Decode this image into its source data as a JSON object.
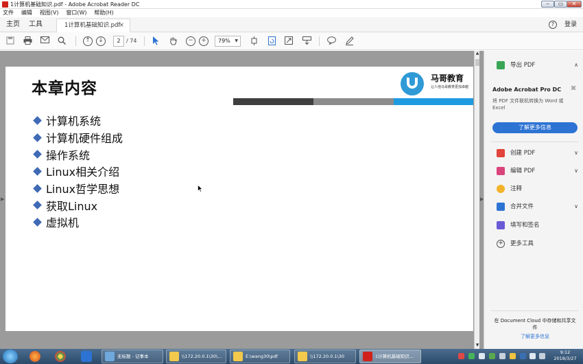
{
  "window": {
    "title": "1计算机基础知识.pdf - Adobe Acrobat Reader DC",
    "minimize": "‒",
    "maximize": "▭",
    "close": "✕"
  },
  "menu": [
    "文件",
    "编辑",
    "视图(V)",
    "窗口(W)",
    "帮助(H)"
  ],
  "nav": {
    "home": "主页",
    "tools": "工具",
    "doc_tab": "1计算机基础知识.pdf",
    "doc_tab_close": "×",
    "help": "?",
    "login": "登录"
  },
  "toolbar": {
    "page_current": "2",
    "page_total": "/ 74",
    "zoom": "79%",
    "icons": [
      "save-icon",
      "print-icon",
      "email-icon",
      "search-icon",
      "page-up-icon",
      "page-down-icon",
      "select-icon",
      "hand-icon",
      "zoom-out-icon",
      "zoom-in-icon",
      "fit-page-icon",
      "rotate-icon",
      "fullscreen-icon",
      "annotate-icon",
      "comment-icon",
      "sign-icon"
    ]
  },
  "document": {
    "heading": "本章内容",
    "logo_brand": "马哥教育",
    "logo_tagline": "让人他马哥教育更加卓越",
    "bullets": [
      "计算机系统",
      "计算机硬件组成",
      "操作系统",
      "Linux相关介绍",
      "Linux哲学思想",
      "获取Linux",
      "虚拟机"
    ],
    "colors": {
      "bar_dark": "#3f3f3f",
      "bar_mid": "#8c8c8c",
      "bar_accent": "#1e9be0",
      "bullet": "#3f6ab5"
    }
  },
  "right_panel": {
    "export_pdf": "导出 PDF",
    "promo_title": "Adobe Acrobat Pro DC",
    "promo_sub": "将 PDF 文件联机转换为 Word 或 Excel",
    "promo_button": "了解更多信息",
    "tools": [
      {
        "label": "创建 PDF",
        "icon": "create-pdf-icon",
        "color": "#e0443a",
        "has_caret": true
      },
      {
        "label": "编辑 PDF",
        "icon": "edit-pdf-icon",
        "color": "#d9447b",
        "has_caret": true
      },
      {
        "label": "注释",
        "icon": "comment-icon",
        "color": "#f2b32a",
        "has_caret": false
      },
      {
        "label": "合并文件",
        "icon": "combine-files-icon",
        "color": "#2d73d3",
        "has_caret": true
      },
      {
        "label": "填写和签名",
        "icon": "fill-sign-icon",
        "color": "#6a5ad6",
        "has_caret": false
      },
      {
        "label": "更多工具",
        "icon": "more-tools-icon",
        "color": "#555555",
        "has_caret": false
      }
    ],
    "footer_text": "在 Document Cloud 中存储和共享文件",
    "footer_link": "了解更多信息"
  },
  "taskbar": {
    "tasks": [
      {
        "label": "无标题 - 记事本",
        "color": "#6fa8dc",
        "active": false
      },
      {
        "label": "\\\\172.20.0.1\\30\\...",
        "color": "#f2c94c",
        "active": false
      },
      {
        "label": "E:\\wang30\\pdf",
        "color": "#f2c94c",
        "active": false
      },
      {
        "label": "\\\\172.20.0.1\\30",
        "color": "#f2c94c",
        "active": false
      },
      {
        "label": "1计算机基础知识...",
        "color": "#d0221c",
        "active": true
      }
    ],
    "time": "9:12",
    "date": "2018/3/27"
  }
}
